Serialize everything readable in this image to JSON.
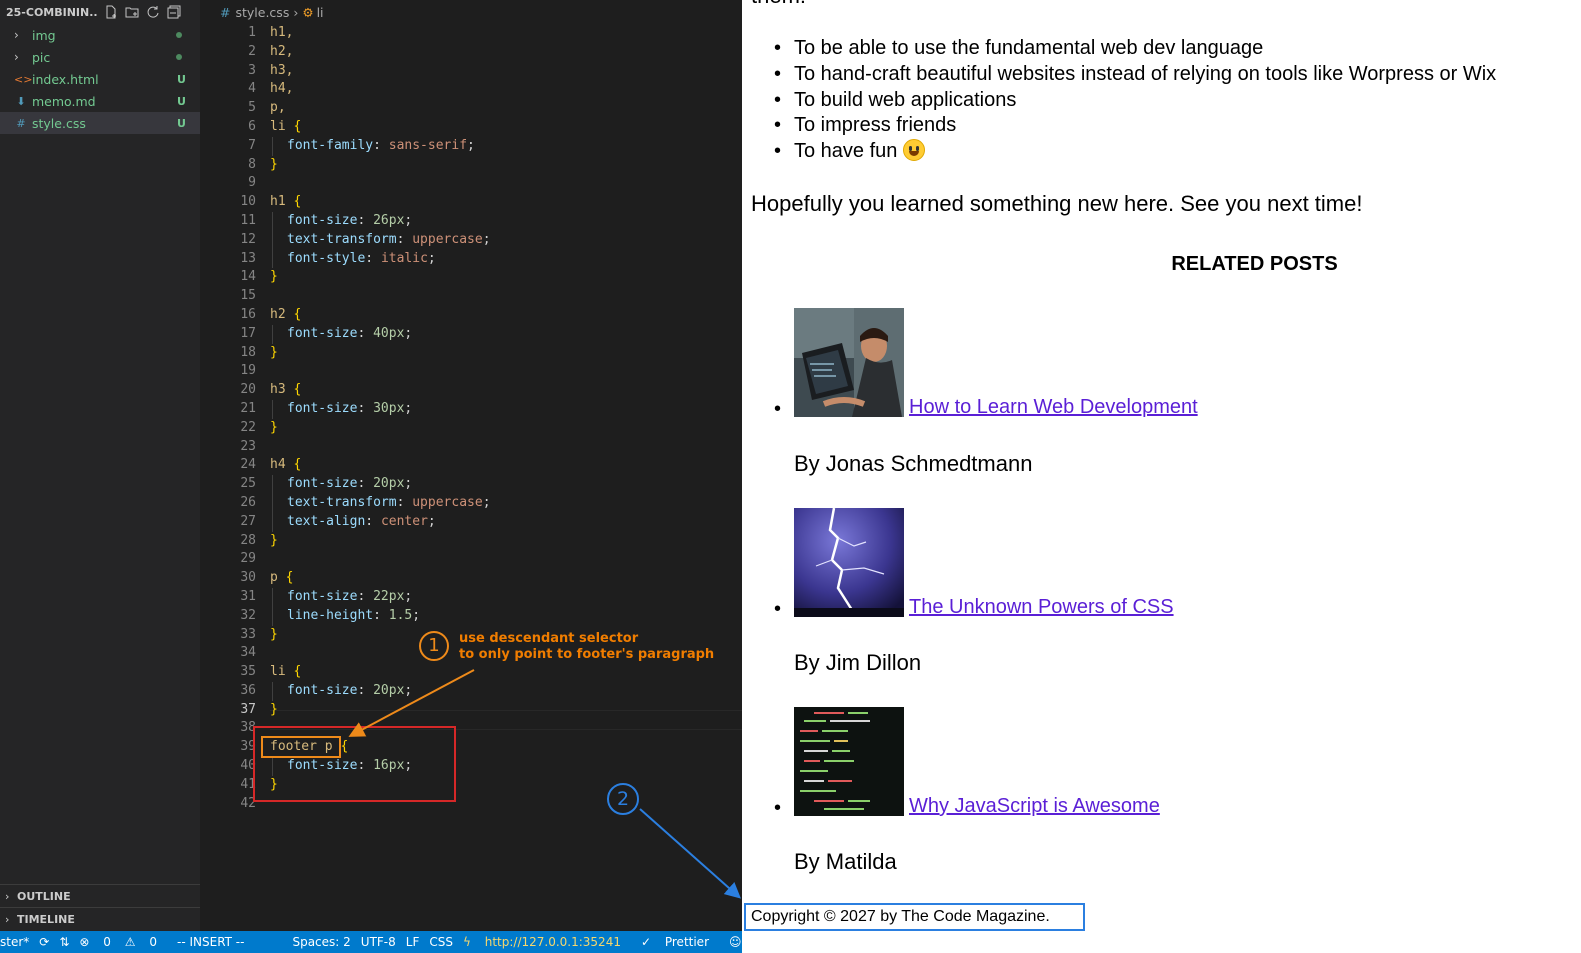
{
  "explorer": {
    "title": "25-COMBININ...",
    "items": [
      {
        "name": "img",
        "type": "folder",
        "status": "dot"
      },
      {
        "name": "pic",
        "type": "folder",
        "status": "dot"
      },
      {
        "name": "index.html",
        "type": "html",
        "status": "U"
      },
      {
        "name": "memo.md",
        "type": "md",
        "status": "U"
      },
      {
        "name": "style.css",
        "type": "css",
        "status": "U",
        "selected": true
      }
    ],
    "panels": [
      "OUTLINE",
      "TIMELINE"
    ]
  },
  "breadcrumb": {
    "file": "style.css",
    "symbol": "li"
  },
  "code": {
    "current_line": 37,
    "lines": [
      "h1,",
      "h2,",
      "h3,",
      "h4,",
      "p,",
      "li {",
      "  font-family: sans-serif;",
      "}",
      "",
      "h1 {",
      "  font-size: 26px;",
      "  text-transform: uppercase;",
      "  font-style: italic;",
      "}",
      "",
      "h2 {",
      "  font-size: 40px;",
      "}",
      "",
      "h3 {",
      "  font-size: 30px;",
      "}",
      "",
      "h4 {",
      "  font-size: 20px;",
      "  text-transform: uppercase;",
      "  text-align: center;",
      "}",
      "",
      "p {",
      "  font-size: 22px;",
      "  line-height: 1.5;",
      "}",
      "",
      "li {",
      "  font-size: 20px;",
      "}",
      "",
      "footer p {",
      "  font-size: 16px;",
      "}",
      ""
    ]
  },
  "annotations": {
    "callout_1_number": "1",
    "callout_1_text": "use descendant selector\nto only point to footer's paragraph",
    "callout_2_number": "2",
    "colors": {
      "orange": "#f07d00",
      "red": "#d62828",
      "blue": "#2b7fe0"
    }
  },
  "preview": {
    "top_cut_text": "them:",
    "reasons": [
      "To be able to use the fundamental web dev language",
      "To hand-craft beautiful websites instead of relying on tools like Worpress or Wix",
      "To build web applications",
      "To impress friends",
      "To have fun"
    ],
    "outro": "Hopefully you learned something new here. See you next time!",
    "related_title": "Related posts",
    "posts": [
      {
        "title": "How to Learn Web Development",
        "author": "By Jonas Schmedtmann",
        "thumb": "person-laptop"
      },
      {
        "title": "The Unknown Powers of CSS",
        "author": "By Jim Dillon",
        "thumb": "lightning"
      },
      {
        "title": "Why JavaScript is Awesome",
        "author": "By Matilda",
        "thumb": "code-screen"
      }
    ],
    "copyright": "Copyright © 2027 by The Code Magazine."
  },
  "statusbar": {
    "branch": "ster*",
    "errors": "0",
    "warnings": "0",
    "mode": "-- INSERT --",
    "spaces": "Spaces: 2",
    "encoding": "UTF-8",
    "eol": "LF",
    "language": "CSS",
    "live_server": "http://127.0.0.1:35241",
    "prettier": "Prettier"
  }
}
